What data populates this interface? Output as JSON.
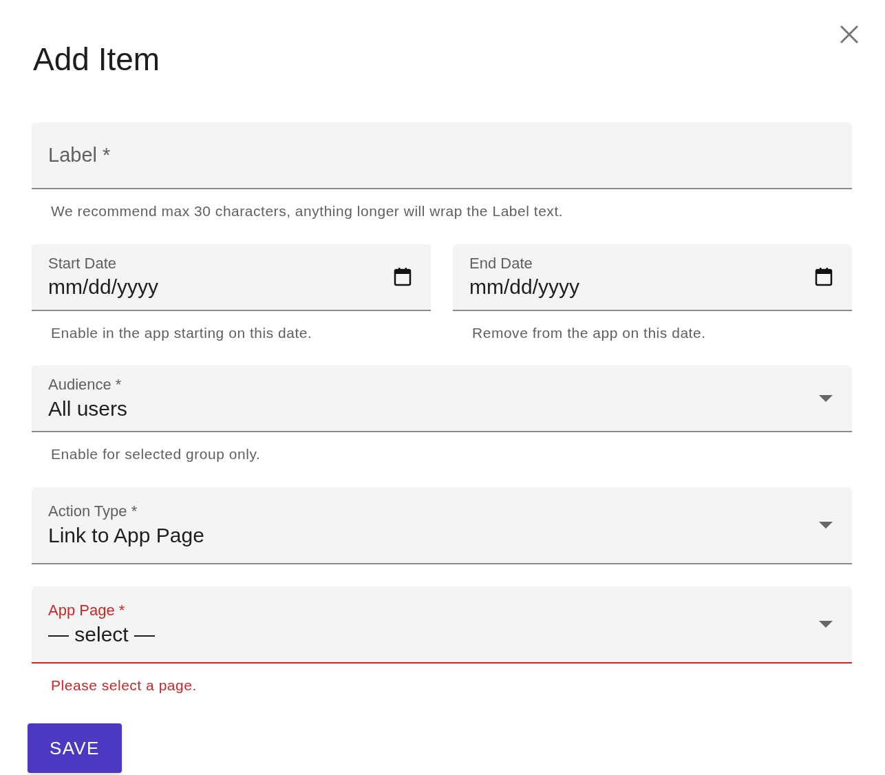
{
  "dialog": {
    "title": "Add Item"
  },
  "rows": [
    {
      "fields": [
        {
          "kind": "text",
          "label": "Label *",
          "error": false,
          "helper": "We recommend max 30 characters, anything longer will wrap the Label text."
        }
      ]
    },
    {
      "fields": [
        {
          "kind": "date",
          "label": "Start Date",
          "value": "mm/dd/yyyy",
          "error": false,
          "helper": "Enable in the app starting on this date."
        },
        {
          "kind": "date",
          "label": "End Date",
          "value": "mm/dd/yyyy",
          "error": false,
          "helper": "Remove from the app on this date."
        }
      ]
    },
    {
      "fields": [
        {
          "kind": "select",
          "label": "Audience *",
          "value": "All users",
          "error": false,
          "helper": "Enable for selected group only."
        }
      ]
    },
    {
      "fields": [
        {
          "kind": "select",
          "label": "Action Type *",
          "value": "Link to App Page",
          "error": false
        }
      ]
    },
    {
      "fields": [
        {
          "kind": "select",
          "label": "App Page *",
          "value": "— select —",
          "error": true,
          "helper": "Please select a page."
        }
      ]
    }
  ],
  "save_button": {
    "label": "SAVE"
  }
}
